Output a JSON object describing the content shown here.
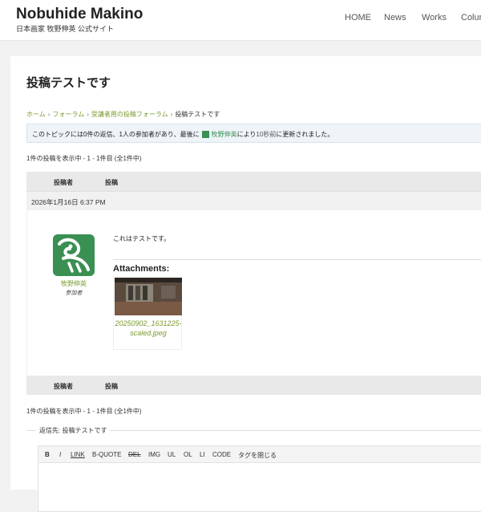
{
  "site": {
    "title": "Nobuhide Makino",
    "description": "日本画家 牧野伸英 公式サイト"
  },
  "nav": {
    "items": [
      "HOME",
      "News",
      "Works",
      "Colur"
    ]
  },
  "topic": {
    "title": "投稿テストです",
    "breadcrumb": [
      "ホーム",
      "フォーラム",
      "受講者用の投稿フォーラム",
      "投稿テストです"
    ],
    "breadcrumb_sep": "›",
    "notice": {
      "prefix": "このトピックには0件の返信、1人の参加者があり、最後に",
      "user": "牧野伸英",
      "mid": "により",
      "time": "10秒前",
      "suffix": "に更新されました。"
    },
    "count_text": "1件の投稿を表示中 - 1 - 1件目 (全1件中)",
    "table": {
      "author_col": "投稿者",
      "post_col": "投稿"
    }
  },
  "post": {
    "date": "2026年1月16日 6:37 PM",
    "author": "牧野伸英",
    "role": "参加者",
    "text": "これはテストです。",
    "attachments_label": "Attachments:",
    "attachment_file": "20250902_1631225-scaled.jpeg"
  },
  "reply": {
    "legend": "返信先: 投稿テストです",
    "toolbar": [
      "B",
      "I",
      "LINK",
      "B-QUOTE",
      "DEL",
      "IMG",
      "UL",
      "OL",
      "LI",
      "CODE",
      "タグを閉じる"
    ]
  },
  "colors": {
    "link": "#7a9a2e",
    "avatar_green": "#3a8f53"
  }
}
